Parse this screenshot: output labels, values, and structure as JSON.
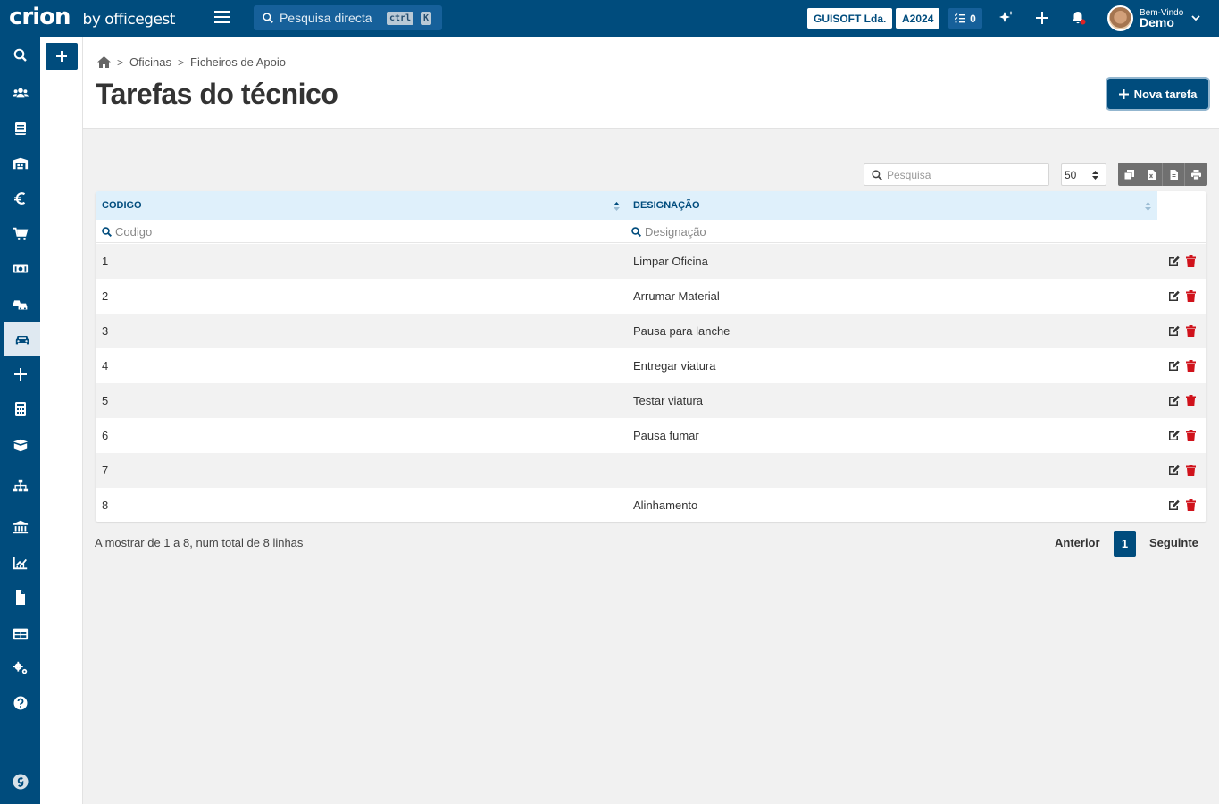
{
  "app": {
    "logo": "crion",
    "by": "by officegest"
  },
  "topbar": {
    "search_placeholder": "Pesquisa directa",
    "shortcut_ctrl": "ctrl",
    "shortcut_key": "K",
    "company": "GUISOFT Lda.",
    "year": "A2024",
    "tasks_count": "0",
    "welcome_label": "Bem-Vindo",
    "user_name": "Demo"
  },
  "breadcrumb": {
    "items": [
      "Oficinas",
      "Ficheiros de Apoio"
    ]
  },
  "page": {
    "title": "Tarefas do técnico",
    "new_button": "Nova tarefa"
  },
  "table": {
    "search_placeholder": "Pesquisa",
    "page_size": "50",
    "columns": [
      "CODIGO",
      "DESIGNAÇÃO"
    ],
    "filter_placeholders": [
      "Codigo",
      "Designação"
    ],
    "rows": [
      {
        "codigo": "1",
        "designacao": "Limpar Oficina"
      },
      {
        "codigo": "2",
        "designacao": "Arrumar Material"
      },
      {
        "codigo": "3",
        "designacao": "Pausa para lanche"
      },
      {
        "codigo": "4",
        "designacao": "Entregar viatura"
      },
      {
        "codigo": "5",
        "designacao": "Testar viatura"
      },
      {
        "codigo": "6",
        "designacao": "Pausa fumar"
      },
      {
        "codigo": "7",
        "designacao": ""
      },
      {
        "codigo": "8",
        "designacao": "Alinhamento"
      }
    ]
  },
  "footer": {
    "info": "A mostrar de 1 a 8, num total de 8 linhas",
    "prev": "Anterior",
    "current_page": "1",
    "next": "Seguinte"
  },
  "sidebar": {
    "icons": [
      "search-icon",
      "users-icon",
      "book-icon",
      "warehouse-icon",
      "euro-icon",
      "cart-icon",
      "money-icon",
      "cars-icon",
      "car-icon",
      "plus-icon",
      "calculator-icon",
      "box-icon",
      "sitemap-icon",
      "bank-icon",
      "chart-icon",
      "file-icon",
      "table-icon",
      "cogs-icon",
      "help-icon",
      "brand-g-icon"
    ],
    "active": "car-icon"
  },
  "colors": {
    "primary": "#004c7d",
    "header_bg": "#dff0fb",
    "delete": "#d0121b"
  }
}
